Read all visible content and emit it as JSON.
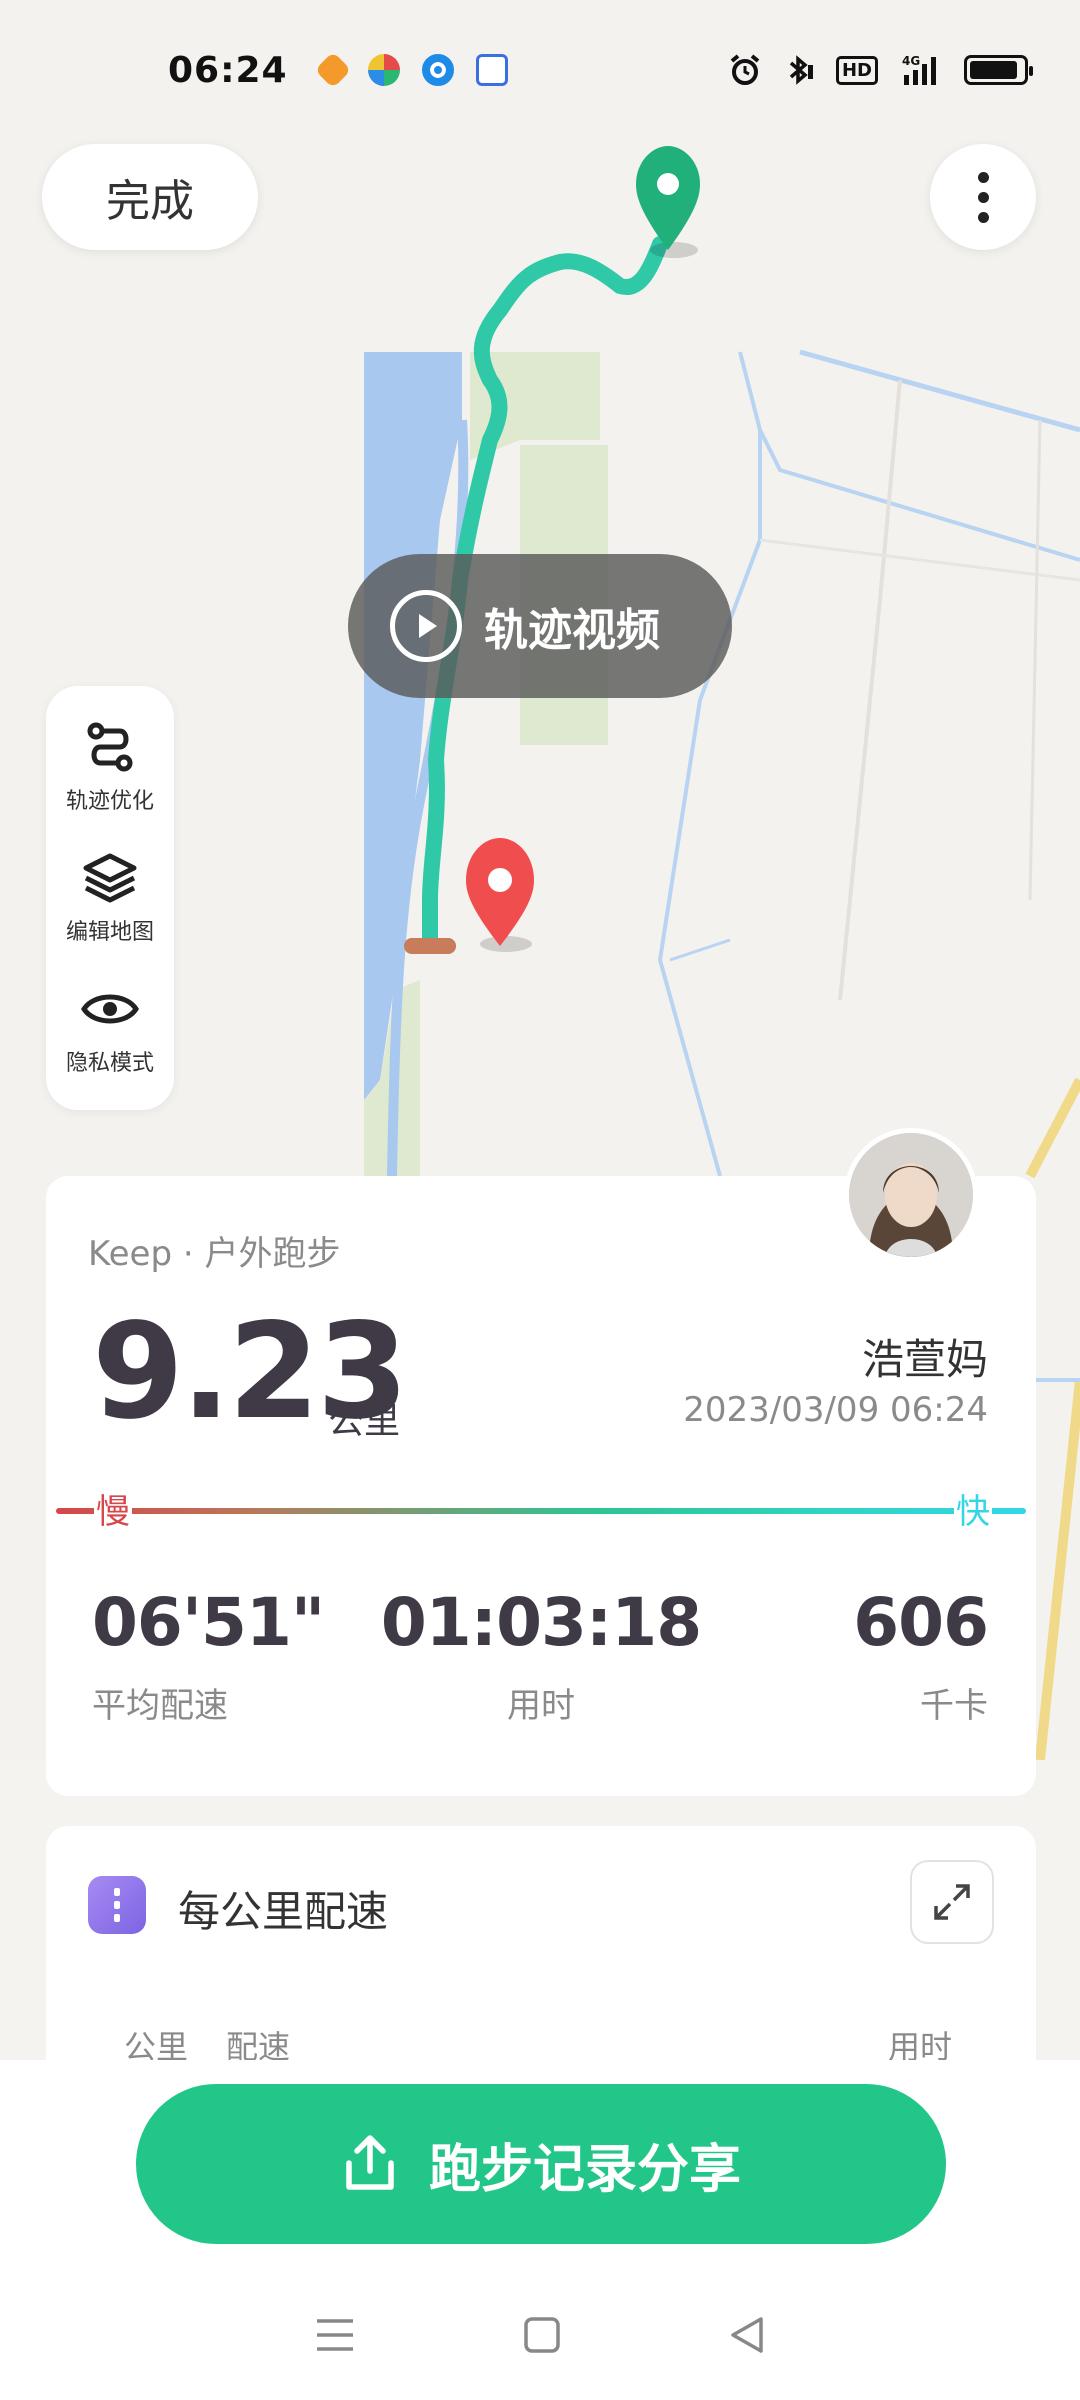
{
  "status_bar": {
    "time": "06:24",
    "app_icons": [
      "heart-app-icon",
      "circle-app-icon",
      "blue-dot-app-icon",
      "baidu-paw-icon"
    ],
    "right_icons": [
      "alarm-icon",
      "bluetooth-icon",
      "hd-icon",
      "signal-4g-icon",
      "battery-icon"
    ],
    "hd_label": "HD",
    "network_label": "4G",
    "battery_level": 0.9
  },
  "top_bar": {
    "done_label": "完成",
    "more_icon": "more-vertical-icon"
  },
  "map": {
    "track_video_label": "轨迹视频",
    "tools": [
      {
        "icon": "route-optimize-icon",
        "label": "轨迹优化"
      },
      {
        "icon": "layers-icon",
        "label": "编辑地图"
      },
      {
        "icon": "eye-icon",
        "label": "隐私模式"
      }
    ],
    "start_marker_color": "#21b07a",
    "end_marker_color": "#f04e4e"
  },
  "summary": {
    "source": "Keep · 户外跑步",
    "distance": "9.23",
    "distance_unit": "公里",
    "user_name": "浩萱妈",
    "date": "2023/03/09 06:24",
    "slow_label": "慢",
    "fast_label": "快",
    "stats": {
      "pace_value": "06'51\"",
      "pace_label": "平均配速",
      "time_value": "01:03:18",
      "time_label": "用时",
      "calories_value": "606",
      "calories_label": "千卡"
    }
  },
  "per_km": {
    "title": "每公里配速",
    "headers": {
      "km": "公里",
      "pace": "配速",
      "time": "用时"
    }
  },
  "share": {
    "label": "跑步记录分享"
  },
  "colors": {
    "accent_green": "#22c688",
    "text_dark": "#3f3a45",
    "text_gray": "#8a8a8a"
  }
}
